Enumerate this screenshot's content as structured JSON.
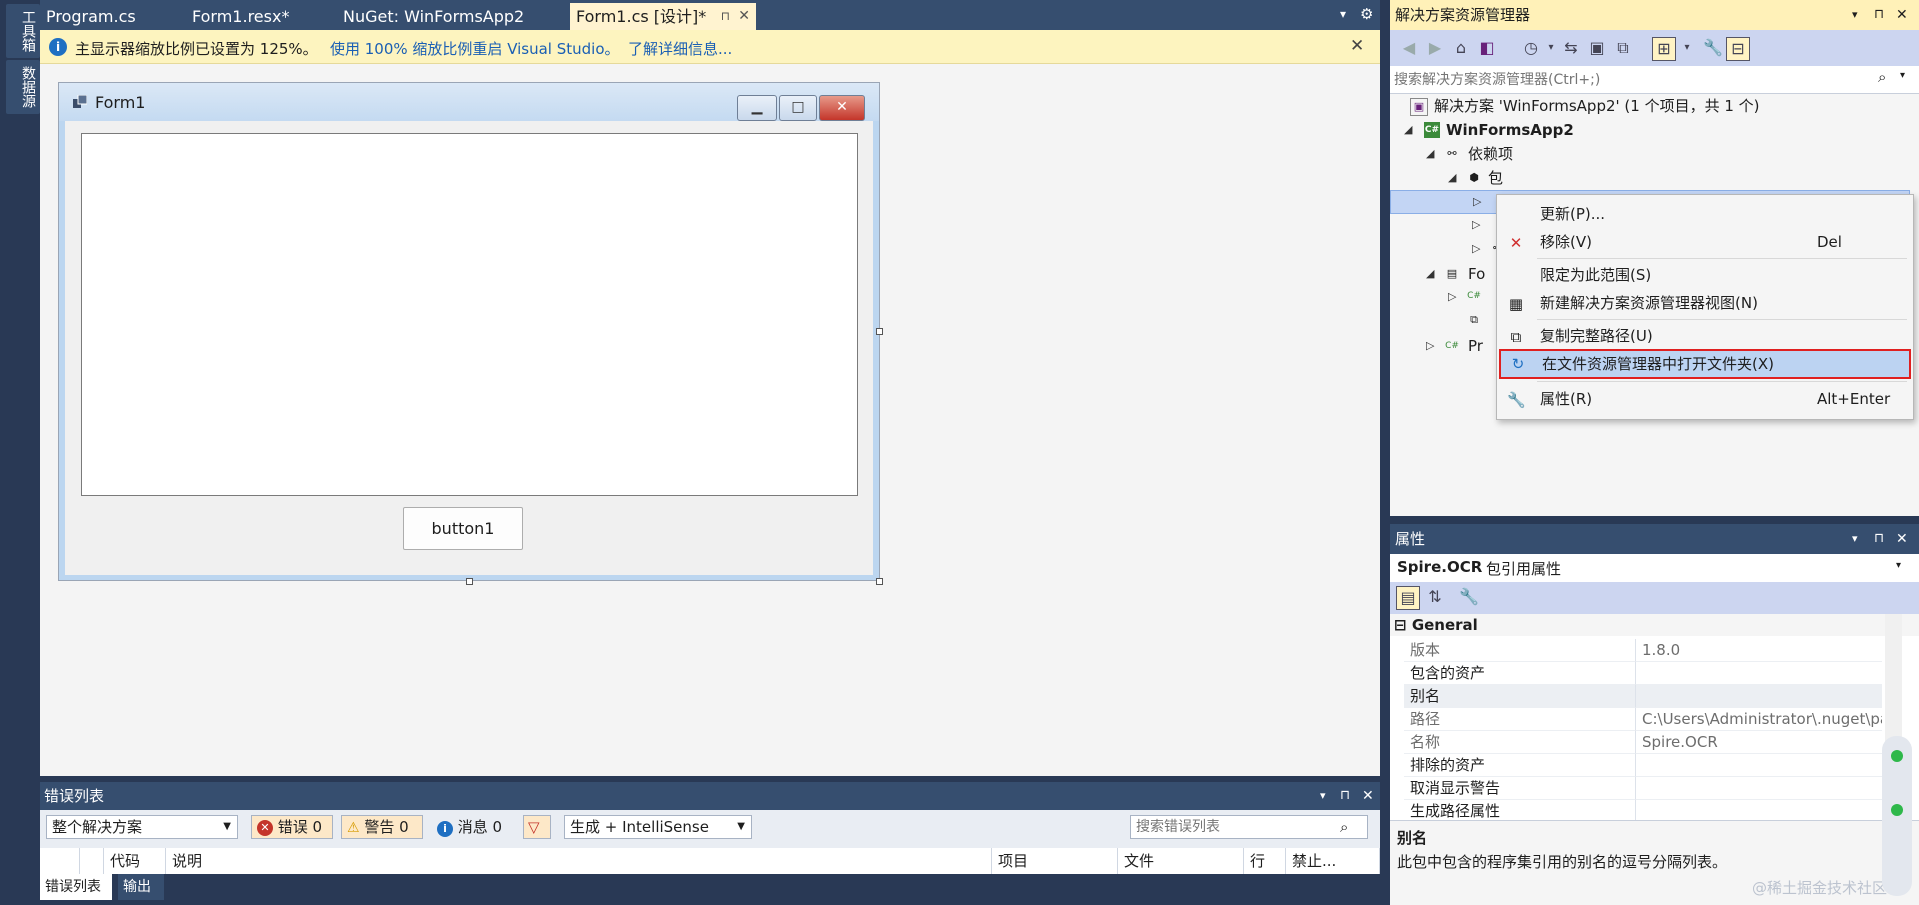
{
  "left_rail": {
    "toolbox": "工具箱",
    "datasource": "数据源"
  },
  "doc_tabs": [
    {
      "label": "Program.cs"
    },
    {
      "label": "Form1.resx*"
    },
    {
      "label": "NuGet: WinFormsApp2"
    },
    {
      "label": "Form1.cs [设计]*",
      "pin": "⊓",
      "close": "✕"
    }
  ],
  "info_bar": {
    "message": "主显示器缩放比例已设置为 125%。",
    "restart_link": "使用 100% 缩放比例重启 Visual Studio。",
    "learn_more": "了解详细信息..."
  },
  "form": {
    "title": "Form1",
    "button": "button1"
  },
  "error_list": {
    "title": "错误列表",
    "scope": "整个解决方案",
    "errors": "错误 0",
    "warnings": "警告 0",
    "messages": "消息 0",
    "build_filter": "生成 + IntelliSense",
    "search_placeholder": "搜索错误列表",
    "columns": [
      "代码",
      "说明",
      "项目",
      "文件",
      "行",
      "禁止..."
    ],
    "tabs": [
      "错误列表",
      "输出"
    ]
  },
  "solution_explorer": {
    "title": "解决方案资源管理器",
    "search_placeholder": "搜索解决方案资源管理器(Ctrl+;)",
    "tree": {
      "solution": "解决方案 'WinFormsApp2' (1 个项目，共 1 个)",
      "project": "WinFormsApp2",
      "dependencies": "依赖项",
      "packages": "包",
      "form_partial": "Fo",
      "program_partial": "Pr"
    }
  },
  "context_menu": {
    "items": [
      {
        "label": "更新(P)...",
        "shortcut": ""
      },
      {
        "label": "移除(V)",
        "shortcut": "Del"
      },
      {
        "label": "限定为此范围(S)",
        "shortcut": ""
      },
      {
        "label": "新建解决方案资源管理器视图(N)",
        "shortcut": ""
      },
      {
        "label": "复制完整路径(U)",
        "shortcut": ""
      },
      {
        "label": "在文件资源管理器中打开文件夹(X)",
        "shortcut": ""
      },
      {
        "label": "属性(R)",
        "shortcut": "Alt+Enter"
      }
    ]
  },
  "properties": {
    "title": "属性",
    "object_name": "Spire.OCR",
    "object_type": "包引用属性",
    "category": "General",
    "rows": [
      {
        "name": "版本",
        "value": "1.8.0"
      },
      {
        "name": "包含的资产",
        "value": ""
      },
      {
        "name": "别名",
        "value": ""
      },
      {
        "name": "路径",
        "value": "C:\\Users\\Administrator\\.nuget\\pac"
      },
      {
        "name": "名称",
        "value": "Spire.OCR"
      },
      {
        "name": "排除的资产",
        "value": ""
      },
      {
        "name": "取消显示警告",
        "value": ""
      },
      {
        "name": "生成路径属性",
        "value": ""
      }
    ],
    "desc_title": "别名",
    "desc_text": "此包中包含的程序集引用的别名的逗号分隔列表。"
  },
  "watermark": "@稀土掘金技术社区",
  "colors": {
    "accent": "#364e6f",
    "highlight_border": "#e02020",
    "info_bg": "#fdf4bf"
  }
}
